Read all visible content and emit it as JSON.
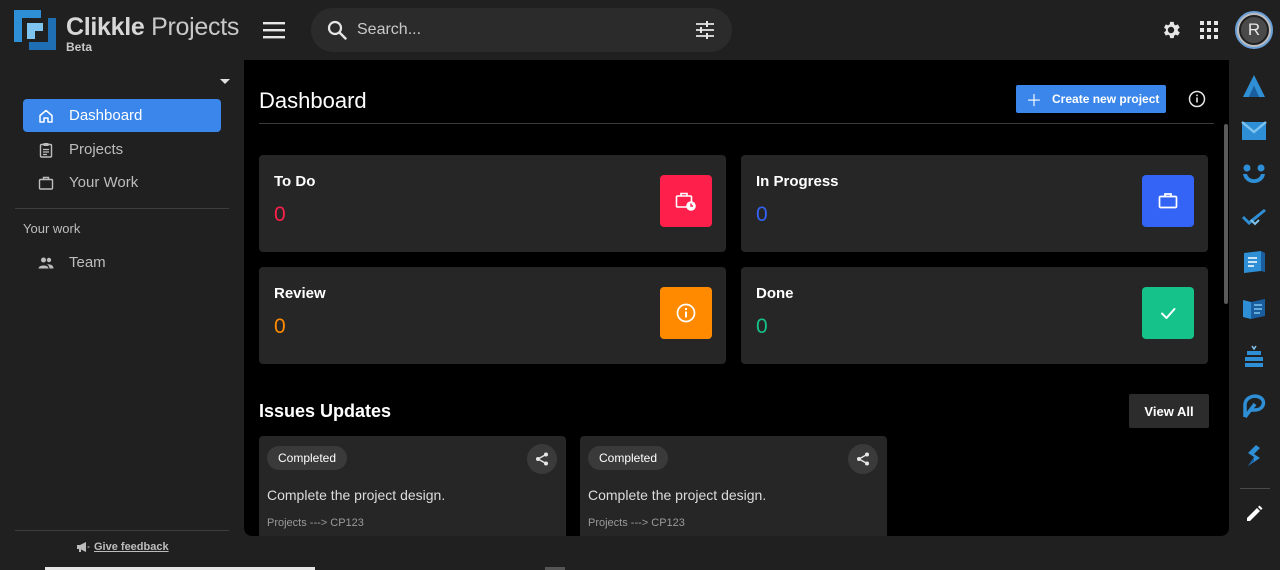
{
  "app": {
    "name_bold": "Clikkle",
    "name_rest": " Projects",
    "tag": "Beta"
  },
  "search": {
    "placeholder": "Search..."
  },
  "user": {
    "initial": "R"
  },
  "sidebar": {
    "items": [
      {
        "label": "Dashboard",
        "icon": "home-icon",
        "active": true
      },
      {
        "label": "Projects",
        "icon": "clipboard-icon",
        "active": false
      },
      {
        "label": "Your Work",
        "icon": "briefcase-icon",
        "active": false
      }
    ],
    "section_label": "Your work",
    "section_items": [
      {
        "label": "Team",
        "icon": "people-icon"
      }
    ],
    "feedback_label": "Give feedback"
  },
  "main": {
    "title": "Dashboard",
    "create_label": "Create new project",
    "stats": [
      {
        "label": "To Do",
        "count": "0",
        "color": "#ff1f4b",
        "icon": "briefcase-clock-icon"
      },
      {
        "label": "In Progress",
        "count": "0",
        "color": "#3364f5",
        "icon": "briefcase-icon"
      },
      {
        "label": "Review",
        "count": "0",
        "color": "#ff8a00",
        "icon": "info-icon"
      },
      {
        "label": "Done",
        "count": "0",
        "color": "#15c28a",
        "icon": "check-icon"
      }
    ],
    "issues_title": "Issues Updates",
    "view_all_label": "View All",
    "issues": [
      {
        "status": "Completed",
        "description": "Complete the project design.",
        "path": "Projects ---> CP123"
      },
      {
        "status": "Completed",
        "description": "Complete the project design.",
        "path": "Projects ---> CP123"
      }
    ]
  },
  "colors": {
    "accent": "#3a86ea",
    "background": "#000000",
    "panel": "#262626"
  }
}
